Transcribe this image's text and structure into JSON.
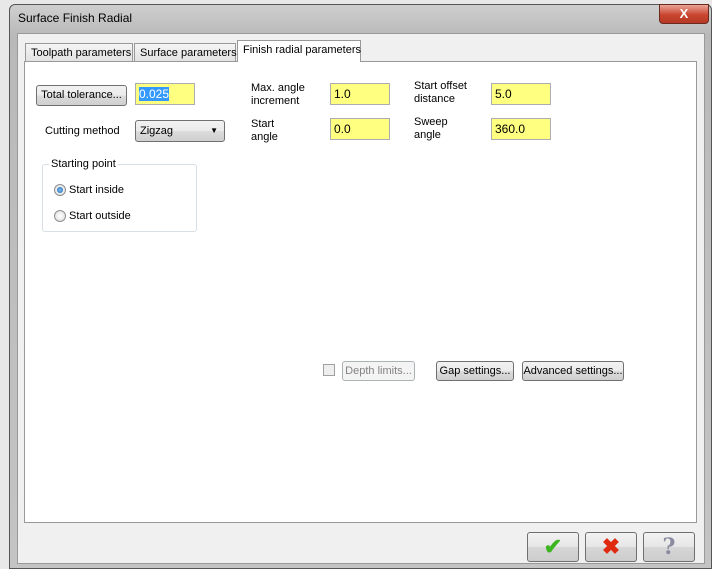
{
  "window": {
    "title": "Surface Finish Radial",
    "close_label": "X"
  },
  "tabs": [
    {
      "label": "Toolpath parameters"
    },
    {
      "label": "Surface parameters"
    },
    {
      "label": "Finish radial parameters",
      "active": true
    }
  ],
  "form": {
    "total_tolerance_label": "Total tolerance...",
    "total_tolerance_value": "0.025",
    "cutting_method_label": "Cutting method",
    "cutting_method_value": "Zigzag",
    "max_angle_label_1": "Max. angle",
    "max_angle_label_2": "increment",
    "max_angle_value": "1.0",
    "start_angle_label_1": "Start",
    "start_angle_label_2": "angle",
    "start_angle_value": "0.0",
    "start_offset_label_1": "Start offset",
    "start_offset_label_2": "distance",
    "start_offset_value": "5.0",
    "sweep_angle_label_1": "Sweep",
    "sweep_angle_label_2": "angle",
    "sweep_angle_value": "360.0",
    "starting_point": {
      "title": "Starting point",
      "options": [
        {
          "label": "Start inside",
          "selected": true
        },
        {
          "label": "Start outside",
          "selected": false
        }
      ]
    },
    "depth_limits_label": "Depth limits...",
    "depth_limits_checked": false,
    "gap_settings_label": "Gap settings...",
    "advanced_settings_label": "Advanced settings..."
  },
  "footer": {
    "ok_icon": "checkmark-icon",
    "cancel_icon": "x-icon",
    "help_icon": "question-icon",
    "ok_glyph": "✔",
    "cancel_glyph": "✖",
    "help_glyph": "?"
  },
  "colors": {
    "field_bg": "#ffff80",
    "ok": "#3cb521",
    "cancel": "#e02a10"
  }
}
